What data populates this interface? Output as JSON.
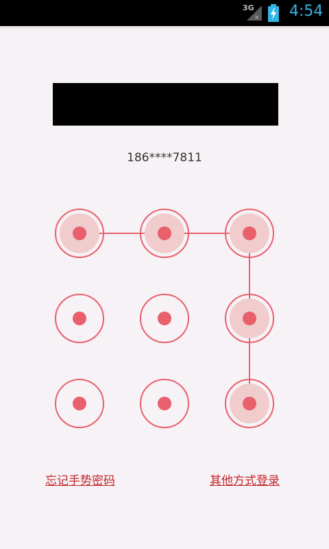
{
  "status_bar": {
    "network": "3G",
    "time": "4:54"
  },
  "account": {
    "phone": "186****7811"
  },
  "pattern": {
    "nodes": [
      {
        "id": 1,
        "selected": true
      },
      {
        "id": 2,
        "selected": true
      },
      {
        "id": 3,
        "selected": true
      },
      {
        "id": 4,
        "selected": false
      },
      {
        "id": 5,
        "selected": false
      },
      {
        "id": 6,
        "selected": true
      },
      {
        "id": 7,
        "selected": false
      },
      {
        "id": 8,
        "selected": false
      },
      {
        "id": 9,
        "selected": true
      }
    ],
    "sequence": [
      1,
      2,
      3,
      6,
      9
    ]
  },
  "links": {
    "forgot": "忘记手势密码",
    "other": "其他方式登录"
  },
  "colors": {
    "accent": "#e8606c",
    "link": "#c2272d",
    "background": "#f7f2f6"
  }
}
